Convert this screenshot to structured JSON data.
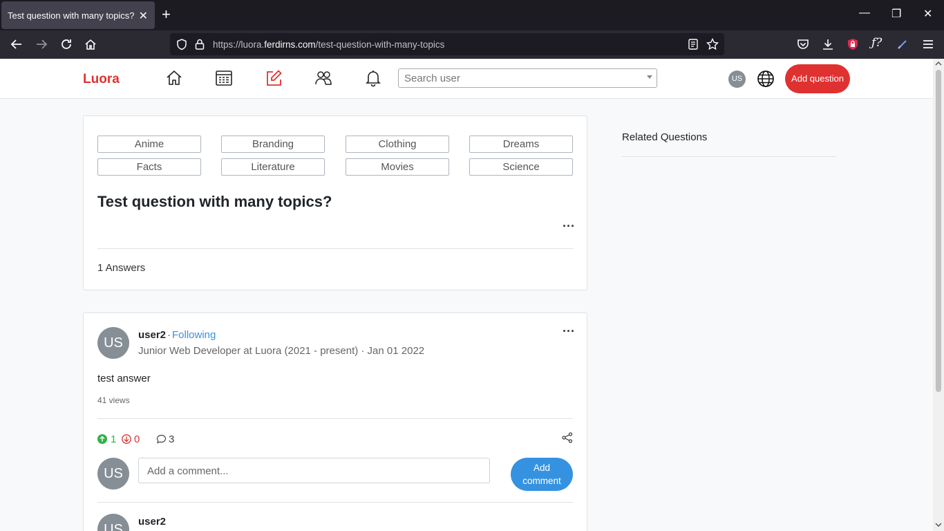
{
  "browser": {
    "tab_title": "Test question with many topics?",
    "url_prefix": "https://luora.",
    "url_host": "ferdirns.com",
    "url_path": "/test-question-with-many-topics"
  },
  "header": {
    "logo": "Luora",
    "search_placeholder": "Search user",
    "avatar_initials": "US",
    "add_question_label": "Add question",
    "accent_color": "#e03131"
  },
  "question": {
    "topics": [
      "Anime",
      "Branding",
      "Clothing",
      "Dreams",
      "Facts",
      "Literature",
      "Movies",
      "Science"
    ],
    "title": "Test question with many topics?",
    "menu": "···",
    "answers_count": "1 Answers"
  },
  "answer": {
    "avatar_initials": "US",
    "username": "user2",
    "separator": "·",
    "following": "Following",
    "credential": "Junior Web Developer at Luora (2021 - present) · Jan 01 2022",
    "menu": "···",
    "text": "test answer",
    "views": "41 views",
    "upvotes": "1",
    "downvotes": "0",
    "comments": "3",
    "comment_avatar": "US",
    "comment_placeholder": "Add a comment...",
    "add_comment_line1": "Add",
    "add_comment_line2": "comment",
    "next_username": "user2",
    "next_avatar": "US"
  },
  "sidebar": {
    "related_title": "Related Questions"
  }
}
